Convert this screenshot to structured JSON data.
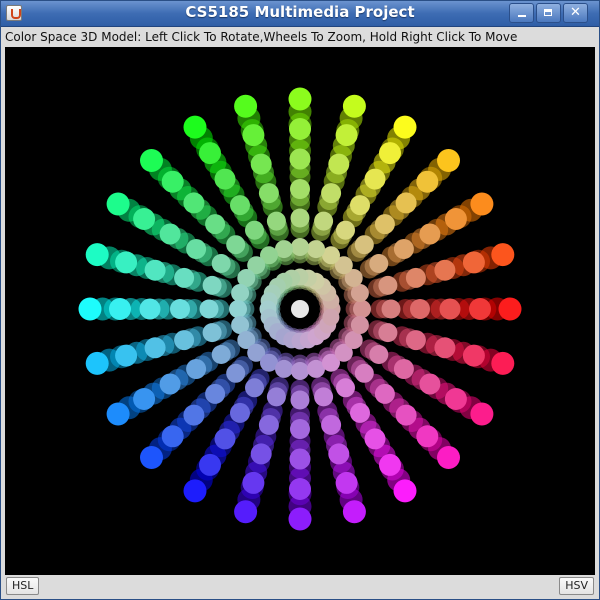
{
  "window": {
    "title": "CS5185 Multimedia Project",
    "controls": {
      "minimize_icon": "minimize-icon",
      "maximize_icon": "maximize-icon",
      "close_icon": "close-icon",
      "close_glyph": "✕"
    }
  },
  "instructions": "Color Space 3D Model: Left Click To Rotate,Wheels To Zoom, Hold Right Click To Move",
  "visualization": {
    "description_type": "3D HSL color space sphere of colored dots",
    "background_color": "#000000",
    "center_color": "#e8e8e8",
    "hue_rays": 24,
    "saturation_rings": 7,
    "depth_layers": 3
  },
  "bottom_buttons": {
    "left": "HSL",
    "right": "HSV"
  }
}
